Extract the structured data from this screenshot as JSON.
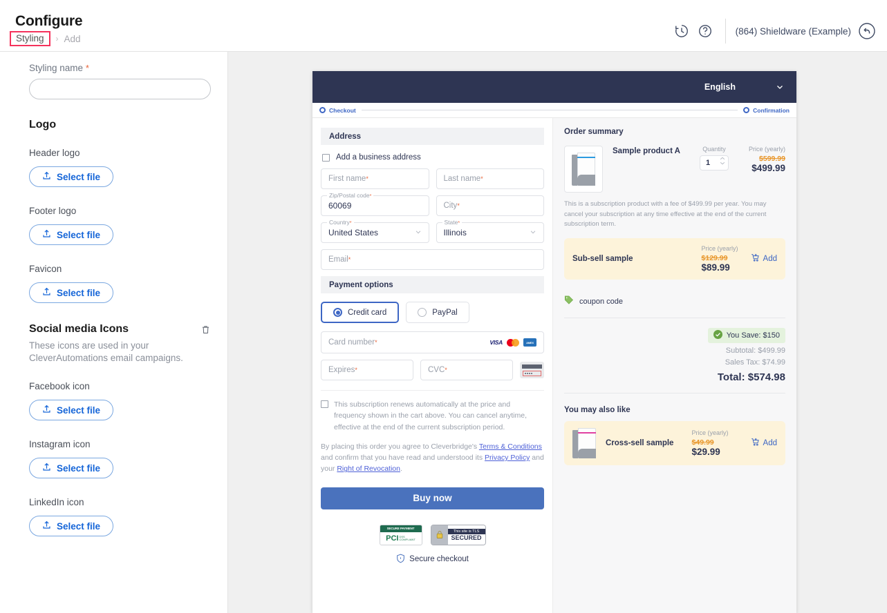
{
  "header": {
    "title": "Configure",
    "breadcrumb_current": "Styling",
    "breadcrumb_sep": "›",
    "breadcrumb_next": "Add",
    "account": "(864) Shieldware (Example)"
  },
  "sidebar": {
    "styling_name_label": "Styling name",
    "required_mark": "*",
    "styling_name_value": "",
    "styling_name_placeholder": "",
    "logo_heading": "Logo",
    "header_logo_label": "Header logo",
    "footer_logo_label": "Footer logo",
    "favicon_label": "Favicon",
    "social_heading": "Social media Icons",
    "social_desc": "These icons are used in your CleverAutomations email campaigns.",
    "facebook_label": "Facebook icon",
    "instagram_label": "Instagram icon",
    "linkedin_label": "LinkedIn icon",
    "select_file": "Select file"
  },
  "checkout": {
    "language": "English",
    "step_checkout": "Checkout",
    "step_confirmation": "Confirmation",
    "address_band": "Address",
    "business_address_label": "Add a business address",
    "first_name_ph": "First name",
    "last_name_ph": "Last name",
    "zip_label": "Zip/Postal code",
    "zip_value": "60069",
    "city_ph": "City",
    "country_label": "Country",
    "country_value": "United States",
    "state_label": "State",
    "state_value": "Illinois",
    "email_ph": "Email",
    "payment_band": "Payment options",
    "credit_card_label": "Credit card",
    "paypal_label": "PayPal",
    "card_number_ph": "Card number",
    "expires_ph": "Expires",
    "cvc_ph": "CVC",
    "visa_label": "VISA",
    "amex_label": "AMERICAN EXPRESS",
    "subscription_note": "This subscription renews automatically at the price and frequency shown in the cart above. You can cancel anytime, effective at the end of the current subscription period.",
    "terms_pre": "By placing this order you agree to Cleverbridge's ",
    "terms_link": "Terms & Conditions",
    "terms_mid": " and confirm that you have read and understood its ",
    "privacy_link": "Privacy Policy",
    "terms_and": " and your ",
    "revocation_link": "Right of Revocation",
    "terms_end": ".",
    "buy_now": "Buy now",
    "pci_top": "SECURE PAYMENT",
    "pci_main": "PCI",
    "pci_sub1": "DSS",
    "pci_sub2": "COMPLIANT",
    "tls_line1": "This site is TLS",
    "tls_line2": "SECURED",
    "secure_checkout": "Secure checkout"
  },
  "order_summary": {
    "title": "Order summary",
    "product_name": "Sample product A",
    "quantity_label": "Quantity",
    "quantity_value": "1",
    "price_label": "Price (yearly)",
    "price_old": "$599.99",
    "price_new": "$499.99",
    "product_desc": "This is a subscription product with a fee of $499.99 per year. You may cancel your subscription at any time effective at the end of the current subscription term.",
    "subsell_name": "Sub-sell sample",
    "subsell_price_label": "Price (yearly)",
    "subsell_price_old": "$129.99",
    "subsell_price_new": "$89.99",
    "add_label": "Add",
    "coupon_code": "coupon code",
    "you_save": "You Save: $150",
    "subtotal_label": "Subtotal:",
    "subtotal_value": "$499.99",
    "tax_label": "Sales Tax:",
    "tax_value": "$74.99",
    "total_label": "Total:",
    "total_value": "$574.98",
    "also_like_title": "You may also like",
    "crosssell_name": "Cross-sell sample",
    "crosssell_price_label": "Price (yearly)",
    "crosssell_price_old": "$49.99",
    "crosssell_price_new": "$29.99",
    "crosssell_add_label": "Add"
  },
  "colors": {
    "accent_blue": "#1565d8",
    "highlight_red": "#f5325b",
    "navy": "#2e3553",
    "button_blue": "#4a72bd",
    "price_orange": "#e8962a",
    "offer_yellow": "#fdf3da",
    "save_green": "#e4f2dd"
  }
}
